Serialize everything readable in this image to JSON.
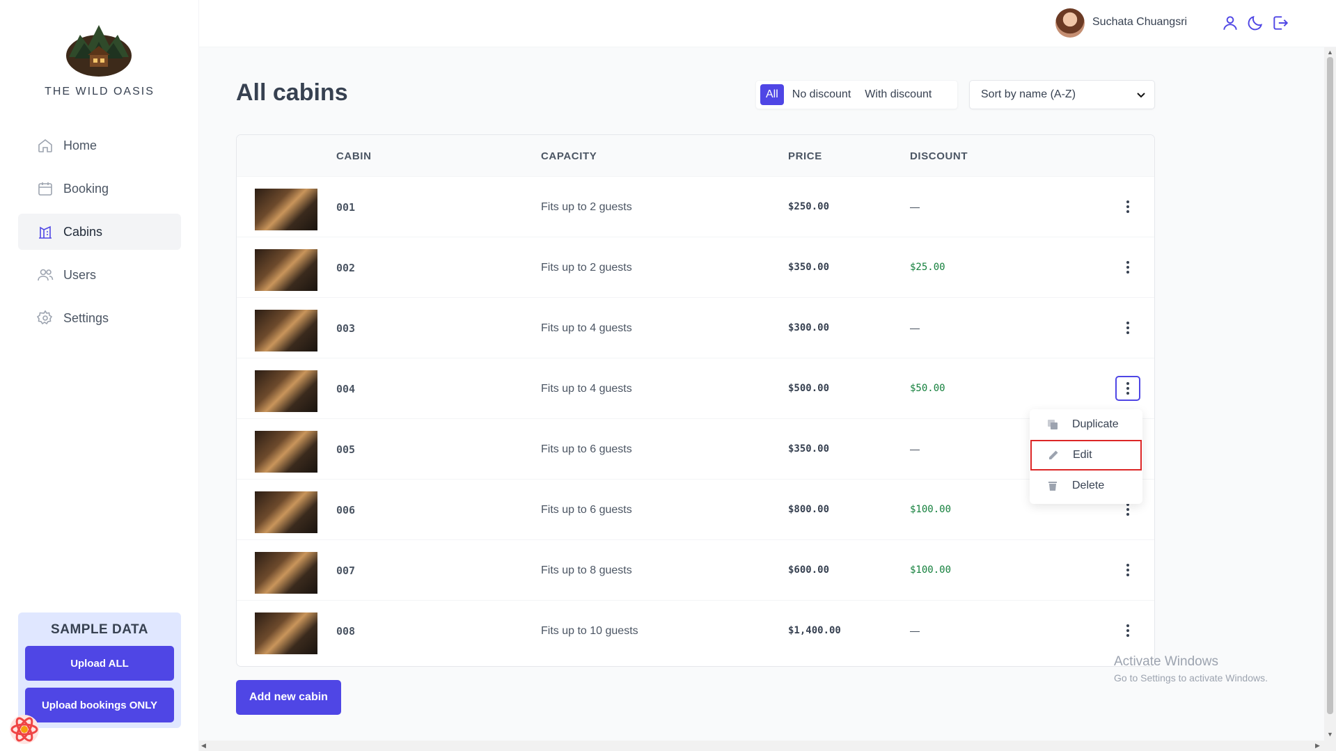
{
  "brand": {
    "name": "THE WILD OASIS"
  },
  "sidebar": {
    "items": [
      {
        "label": "Home",
        "icon": "home-icon"
      },
      {
        "label": "Booking",
        "icon": "calendar-icon"
      },
      {
        "label": "Cabins",
        "icon": "cabins-icon",
        "active": true
      },
      {
        "label": "Users",
        "icon": "users-icon"
      },
      {
        "label": "Settings",
        "icon": "gear-icon"
      }
    ],
    "sample": {
      "title": "SAMPLE DATA",
      "upload_all": "Upload ALL",
      "upload_bookings": "Upload bookings ONLY"
    }
  },
  "header": {
    "user_name": "Suchata Chuangsri",
    "icons": [
      "user-icon",
      "moon-icon",
      "logout-icon"
    ]
  },
  "main": {
    "title": "All cabins",
    "filters": [
      "All",
      "No discount",
      "With discount"
    ],
    "active_filter": "All",
    "sort_selected": "Sort by name (A-Z)",
    "add_button": "Add new cabin"
  },
  "table": {
    "headers": [
      "CABIN",
      "CAPACITY",
      "PRICE",
      "DISCOUNT"
    ],
    "rows": [
      {
        "name": "001",
        "capacity": "Fits up to 2 guests",
        "price": "$250.00",
        "discount": "—"
      },
      {
        "name": "002",
        "capacity": "Fits up to 2 guests",
        "price": "$350.00",
        "discount": "$25.00"
      },
      {
        "name": "003",
        "capacity": "Fits up to 4 guests",
        "price": "$300.00",
        "discount": "—"
      },
      {
        "name": "004",
        "capacity": "Fits up to 4 guests",
        "price": "$500.00",
        "discount": "$50.00"
      },
      {
        "name": "005",
        "capacity": "Fits up to 6 guests",
        "price": "$350.00",
        "discount": "—"
      },
      {
        "name": "006",
        "capacity": "Fits up to 6 guests",
        "price": "$800.00",
        "discount": "$100.00"
      },
      {
        "name": "007",
        "capacity": "Fits up to 8 guests",
        "price": "$600.00",
        "discount": "$100.00"
      },
      {
        "name": "008",
        "capacity": "Fits up to 10 guests",
        "price": "$1,400.00",
        "discount": "—"
      }
    ]
  },
  "context_menu": {
    "items": [
      "Duplicate",
      "Edit",
      "Delete"
    ],
    "highlighted": "Edit"
  },
  "watermark": {
    "line1": "Activate Windows",
    "line2": "Go to Settings to activate Windows."
  },
  "colors": {
    "accent": "#4f46e5",
    "discount": "#15803d",
    "highlight_border": "#dc2626"
  }
}
